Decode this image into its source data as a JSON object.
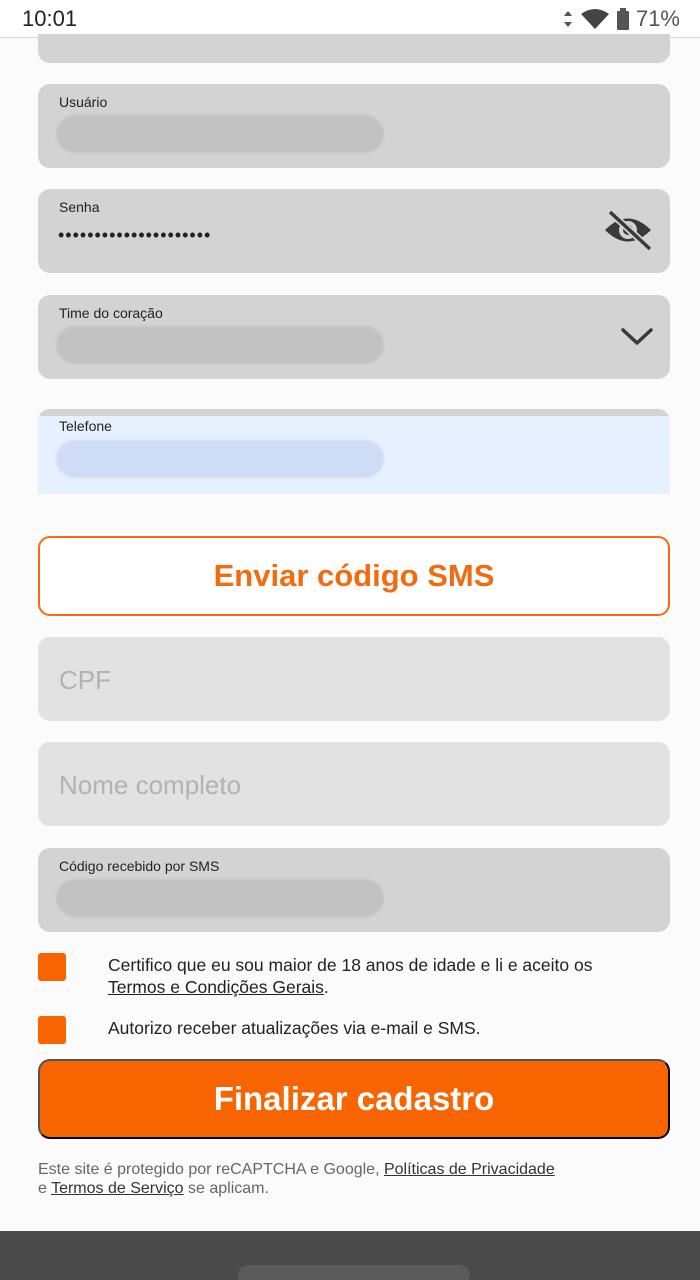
{
  "status_bar": {
    "time": "10:01",
    "battery_pct": "71%"
  },
  "form": {
    "usuario": {
      "label": "Usuário"
    },
    "senha": {
      "label": "Senha",
      "value": "•••••••••••••••••••••"
    },
    "time": {
      "label": "Time do coração"
    },
    "telefone": {
      "label": "Telefone"
    },
    "sms_button": "Enviar código SMS",
    "cpf": {
      "placeholder": "CPF"
    },
    "nome": {
      "placeholder": "Nome completo"
    },
    "codigo": {
      "label": "Código recebido por SMS"
    },
    "consent_age": {
      "text": "Certifico que eu sou maior de 18 anos de idade e li e aceito os",
      "link": "Termos e Condições Gerais",
      "suffix": "."
    },
    "consent_updates": {
      "text": "Autorizo receber atualizações via e-mail e SMS."
    },
    "submit": "Finalizar cadastro",
    "legal": {
      "prefix": "Este site é protegido por reCAPTCHA e Google,",
      "privacy_link": "Políticas de Privacidade",
      "connector": "e",
      "terms_link": "Termos de Serviço",
      "suffix": "se aplicam."
    }
  },
  "colors": {
    "accent": "#f86400",
    "field_bg": "#d3d3d3",
    "autofill_bg": "#e7f0fe"
  }
}
